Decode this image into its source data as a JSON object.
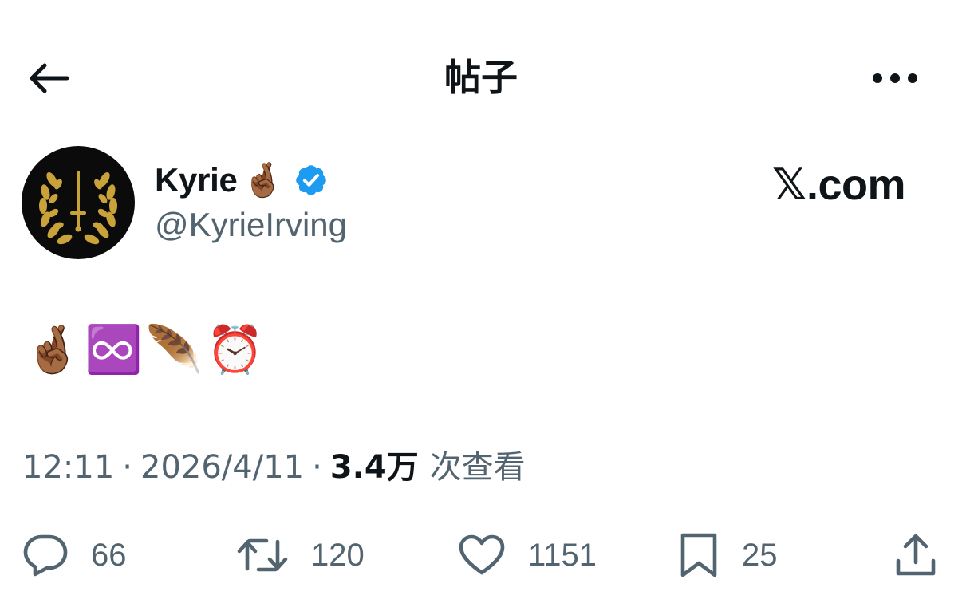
{
  "header": {
    "title": "帖子",
    "back_icon": "arrow-left-icon",
    "more_icon": "more-horizontal-icon"
  },
  "author": {
    "name": "Kyrie",
    "name_emoji": "🤞🏾",
    "handle": "@KyrieIrving",
    "verified": true,
    "verified_color": "#1d9bf0",
    "avatar_icon": "laurel-wreath-sword-icon"
  },
  "brand": "𝕏.com",
  "tweet": {
    "text": "🤞🏾♾️🪶⏰"
  },
  "meta": {
    "time": "12:11",
    "separator": "·",
    "date": "2026/4/11",
    "views_count": "3.4万",
    "views_label": "次查看"
  },
  "actions": {
    "replies": "66",
    "retweets": "120",
    "likes": "1151",
    "bookmarks": "25"
  },
  "colors": {
    "text_primary": "#0f1419",
    "text_secondary": "#536471",
    "verified": "#1d9bf0",
    "avatar_bg": "#0b0b0b",
    "avatar_gold": "#c9a23a"
  }
}
